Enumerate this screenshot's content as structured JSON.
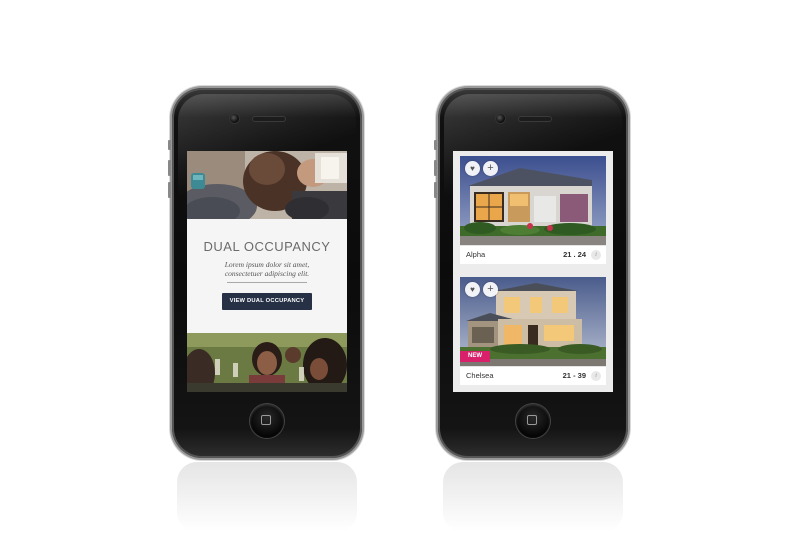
{
  "left_screen": {
    "promo": {
      "title": "DUAL OCCUPANCY",
      "subtitle_line1": "Lorem ipsum dolor sit amet,",
      "subtitle_line2": "consectetuer adipiscing elit.",
      "button_label": "VIEW DUAL OCCUPANCY"
    }
  },
  "right_screen": {
    "listings": [
      {
        "name": "Alpha",
        "size": "21 . 24",
        "info_icon": "i",
        "favorite_icon": "♥",
        "add_icon": "+"
      },
      {
        "name": "Chelsea",
        "size": "21 - 39",
        "info_icon": "i",
        "favorite_icon": "♥",
        "add_icon": "+",
        "badge": "NEW"
      }
    ]
  },
  "colors": {
    "button_navy": "#263146",
    "badge_pink": "#d8206b",
    "promo_background": "#f5f5f5"
  }
}
